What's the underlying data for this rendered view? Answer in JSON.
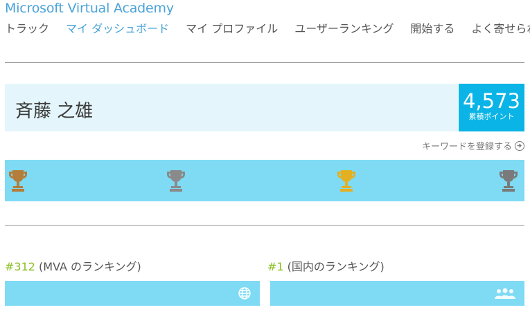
{
  "site": {
    "title": "Microsoft Virtual Academy"
  },
  "nav": {
    "items": [
      "トラック",
      "マイ ダッシュボード",
      "マイ プロファイル",
      "ユーザーランキング",
      "開始する",
      "よく寄せられ"
    ],
    "active_index": 1
  },
  "profile": {
    "name": "斉藤 之雄",
    "points_value": "4,573",
    "points_label": "累積ポイント",
    "register_keywords": "キーワードを登録する"
  },
  "trophies": [
    {
      "icon": "trophy-icon",
      "color": "#b47d3a"
    },
    {
      "icon": "trophy-icon",
      "color": "#8a8a8a"
    },
    {
      "icon": "trophy-icon",
      "color": "#e3b022"
    },
    {
      "icon": "trophy-icon",
      "color": "#7a7a7a"
    }
  ],
  "rankings": {
    "mva": {
      "rank": "#312",
      "label": " (MVA のランキング)",
      "icon": "globe-icon"
    },
    "country": {
      "rank": "#1",
      "label": " (国内のランキング)",
      "icon": "people-icon"
    }
  },
  "colors": {
    "brand": "#4aa3d8",
    "points_bg": "#0ab4e6",
    "name_band_bg": "#e4f6fc",
    "trophy_band_bg": "#7fdaf4",
    "rank_number": "#8cbf26"
  }
}
